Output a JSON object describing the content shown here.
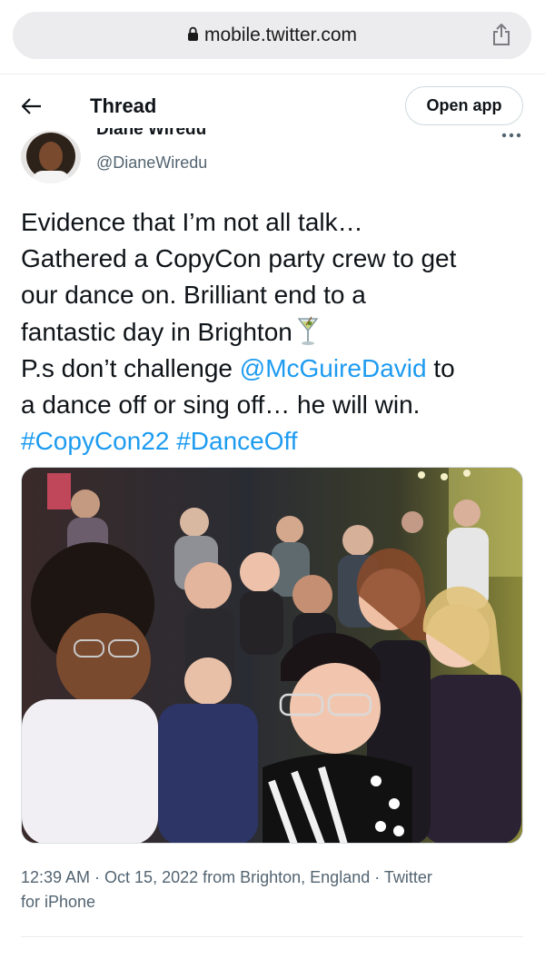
{
  "browser": {
    "url": "mobile.twitter.com"
  },
  "header": {
    "title": "Thread",
    "open_app_label": "Open app"
  },
  "author": {
    "name": "Diane Wiredu",
    "handle": "@DianeWiredu"
  },
  "tweet": {
    "line1": "Evidence that I’m not all talk…",
    "line2": "Gathered a CopyCon party crew to get",
    "line3": "our dance on. Brilliant end to a",
    "line4": "fantastic day in Brighton",
    "line5_pre": "P.s don’t challenge ",
    "line5_mention": "@McGuireDavid",
    "line5_post": " to",
    "line6": "a dance off or sing off… he will win.",
    "hashtag1": "#CopyCon22",
    "hashtag2": "#DanceOff",
    "emoji": "cocktail-glass",
    "link_color": "#1d9bf0"
  },
  "meta": {
    "line1": "12:39 AM · Oct 15, 2022 from Brighton, England · Twitter",
    "line2": "for iPhone"
  }
}
